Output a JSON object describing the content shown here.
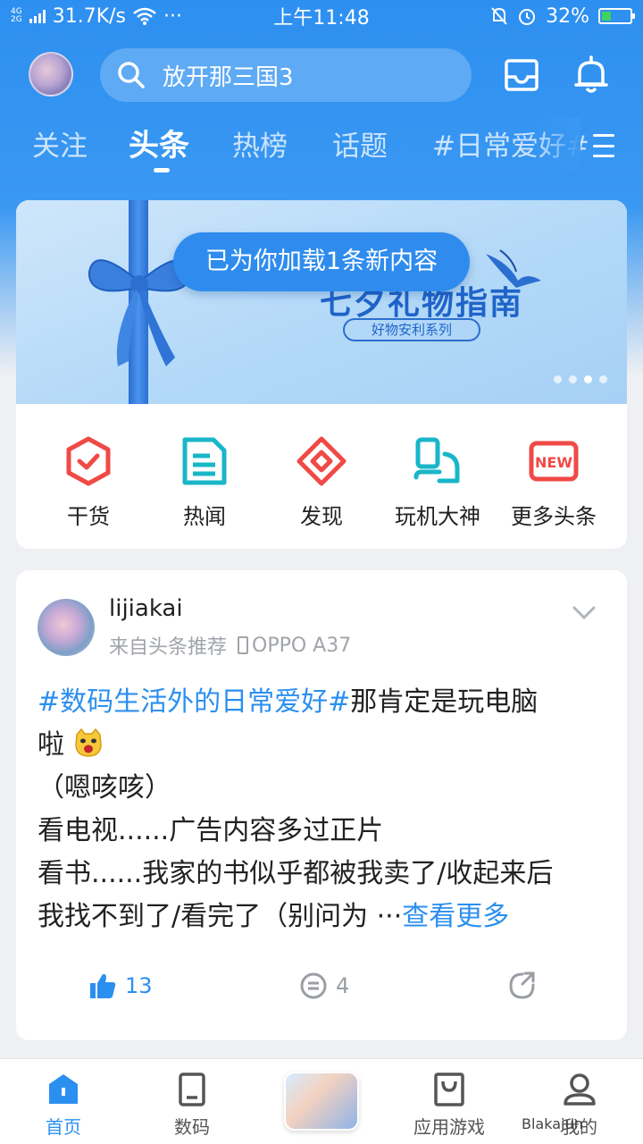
{
  "status_bar": {
    "network_top": "4G",
    "network_bottom": "2G",
    "speed": "31.7K/s",
    "dots": "···",
    "time": "上午11:48",
    "battery": "32%",
    "battery_level": 0.32
  },
  "header": {
    "search_placeholder": "放开那三国3"
  },
  "tabs": {
    "items": [
      {
        "label": "关注"
      },
      {
        "label": "头条"
      },
      {
        "label": "热榜"
      },
      {
        "label": "话题"
      },
      {
        "label": "#日常爱好#"
      }
    ],
    "active": "头条"
  },
  "banner": {
    "title": "七夕礼物指南",
    "tag": "好物安利系列",
    "toast": "已为你加载1条新内容",
    "slide_count": 4,
    "active_slide": 3
  },
  "quick_links": {
    "items": [
      {
        "label": "干货",
        "color": "#f04a46"
      },
      {
        "label": "热闻",
        "color": "#19b6c8"
      },
      {
        "label": "发现",
        "color": "#f04a46"
      },
      {
        "label": "玩机大神",
        "color": "#19b6c8"
      },
      {
        "label": "更多头条",
        "color": "#f04a46"
      }
    ]
  },
  "post": {
    "author": "lijiakai",
    "source": "来自头条推荐",
    "device": "OPPO A37",
    "tag": "#数码生活外的日常爱好#",
    "line1": "那肯定是玩电脑",
    "line2": "啦",
    "line3": "（嗯咳咳）",
    "line4": "看电视......广告内容多过正片",
    "line5": "看书......我家的书似乎都被我卖了/收起来后",
    "line6": "我找不到了/看完了（别问为 ···",
    "more": "查看更多",
    "likes": "13",
    "comments": "4"
  },
  "bottom_nav": {
    "items": [
      {
        "label": "首页"
      },
      {
        "label": "数码"
      },
      {
        "label": "应用游戏"
      },
      {
        "label": "我的"
      }
    ],
    "watermark": "Blakajun"
  },
  "colors": {
    "accent": "#2b8ff0",
    "header": "#2d8ff0",
    "red_icon": "#f04a46",
    "teal_icon": "#19b6c8"
  }
}
